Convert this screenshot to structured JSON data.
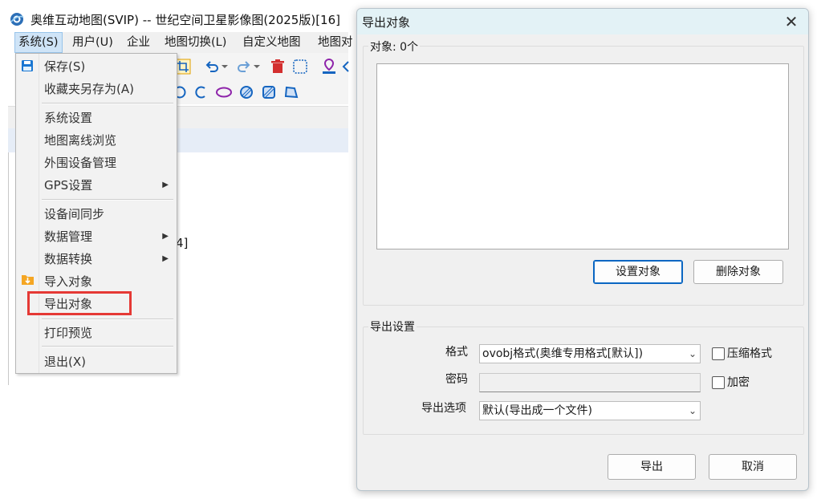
{
  "app": {
    "title": "奥维互动地图(SVIP) -- 世纪空间卫星影像图(2025版)[16]",
    "menubar": [
      "系统(S)",
      "用户(U)",
      "企业",
      "地图切换(L)",
      "自定义地图",
      "地图对"
    ],
    "fragment_text": "4]"
  },
  "system_menu": {
    "items": [
      {
        "label": "保存(S)"
      },
      {
        "label": "收藏夹另存为(A)"
      },
      {
        "label": "系统设置"
      },
      {
        "label": "地图离线浏览"
      },
      {
        "label": "外围设备管理"
      },
      {
        "label": "GPS设置"
      },
      {
        "label": "设备间同步"
      },
      {
        "label": "数据管理"
      },
      {
        "label": "数据转换"
      },
      {
        "label": "导入对象"
      },
      {
        "label": "导出对象"
      },
      {
        "label": "打印预览"
      },
      {
        "label": "退出(X)"
      }
    ],
    "highlight_color": "#e53935"
  },
  "dialog": {
    "title": "导出对象",
    "objects_group_label": "对象: 0个",
    "set_objects_button": "设置对象",
    "delete_objects_button": "删除对象",
    "export_settings_label": "导出设置",
    "format_label": "格式",
    "format_value": "ovobj格式(奥维专用格式[默认])",
    "compress_label": "压缩格式",
    "password_label": "密码",
    "encrypt_label": "加密",
    "export_options_label": "导出选项",
    "export_options_value": "默认(导出成一个文件)",
    "export_button": "导出",
    "cancel_button": "取消"
  }
}
